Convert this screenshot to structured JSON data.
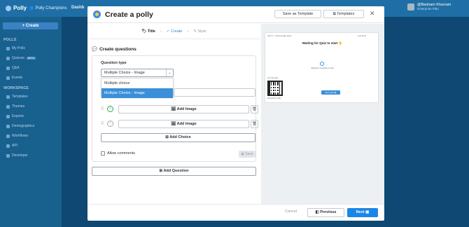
{
  "app": {
    "logo": "Polly",
    "team": "Polly Champions",
    "tab": "Dashb",
    "user_name": "@Basham Khurram",
    "user_plan": "Enterprise Plan"
  },
  "sidebar": {
    "create_label": "Create",
    "section_polls": "POLLS",
    "section_workspace": "WORKSPACE",
    "items": [
      {
        "label": "My Polls"
      },
      {
        "label": "Quizzes",
        "badge": "BETA"
      },
      {
        "label": "Q&A"
      },
      {
        "label": "Events"
      }
    ],
    "workspace_items": [
      {
        "label": "Templates"
      },
      {
        "label": "Themes"
      },
      {
        "label": "Exports"
      },
      {
        "label": "Demographics"
      },
      {
        "label": "Workflows"
      },
      {
        "label": "API"
      },
      {
        "label": "Developer"
      }
    ]
  },
  "modal": {
    "title": "Create a polly",
    "save_template": "Save as Template",
    "templates": "Templates",
    "steps": [
      "Title",
      "Create",
      "Style"
    ],
    "section_title": "Create questions",
    "question_type_label": "Question type",
    "question_type_value": "Multiple Choice - Image",
    "dropdown_options": [
      "Multiple choice",
      "Multiple Choice - Image"
    ],
    "add_image": "Add Image",
    "add_choice": "Add Choice",
    "allow_comments": "Allow comments",
    "save": "Save",
    "add_question": "Add Question",
    "cancel": "Cancel",
    "previous": "Previous",
    "next": "Next"
  },
  "preview": {
    "header": "Quiz 1 · Polly Image Quiz",
    "controls": "Link",
    "waiting": "Waiting for Quiz to start",
    "sub": "Waiting for moderator to start",
    "join": "Join this polly",
    "brand": "Powered by Polly",
    "start": "Start Quiz"
  },
  "colors": {
    "primary": "#1a87e8",
    "selected_option": "#3a8fd8",
    "success": "#2fa84f"
  }
}
